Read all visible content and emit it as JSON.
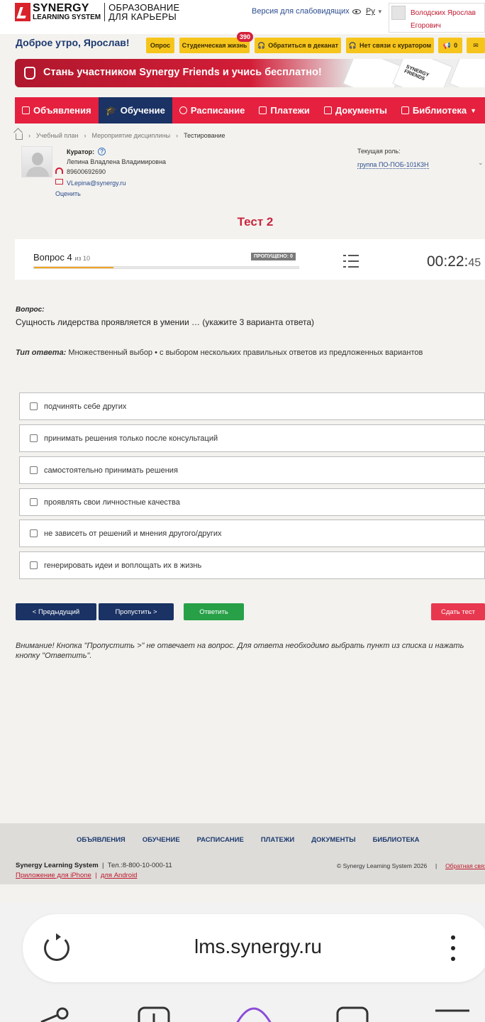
{
  "header": {
    "logo_main": "SYNERGY",
    "logo_sub": "LEARNING SYSTEM",
    "logo_right1": "ОБРАЗОВАНИЕ",
    "logo_right2": "ДЛЯ КАРЬЕРЫ",
    "vision_label": "Версия для слабовидящих",
    "lang": "Ру",
    "user_name": "Володских Ярослав Егорович"
  },
  "greeting": "Доброе утро, Ярослав!",
  "quick_buttons": {
    "survey": "Опрос",
    "student_life": "Студенческая жизнь",
    "student_life_badge": "390",
    "dean": "Обратиться в деканат",
    "curator": "Нет связи с куратором",
    "notifications_count": "0"
  },
  "banner": {
    "text": "Стань участником Synergy Friends и учись бесплатно!",
    "card_text": "SYNERGY FRIENDS"
  },
  "nav": {
    "items": [
      {
        "label": "Объявления"
      },
      {
        "label": "Обучение"
      },
      {
        "label": "Расписание"
      },
      {
        "label": "Платежи"
      },
      {
        "label": "Документы"
      },
      {
        "label": "Библиотека"
      }
    ]
  },
  "breadcrumb": [
    "Учебный план",
    "Мероприятие дисциплины",
    "Тестирование"
  ],
  "curator": {
    "label": "Куратор:",
    "name": "Лепина Владлена Владимировна",
    "phone": "89600692690",
    "email": "VLepina@synergy.ru",
    "rate": "Оценить"
  },
  "role": {
    "label": "Текущая роль:",
    "value": "группа ПО-ПОБ-101К3Н"
  },
  "test": {
    "title": "Тест 2",
    "question_label": "Вопрос 4",
    "question_of": "из 10",
    "skipped": "ПРОПУЩЕНО: 0",
    "progress": 0.3,
    "timer_main": "00:22:",
    "timer_sec": "45"
  },
  "question": {
    "head": "Вопрос:",
    "text": "Сущность лидерства проявляется в умении … (укажите 3 варианта ответа)",
    "type_label": "Тип ответа:",
    "type_text": "Множественный выбор • с выбором нескольких правильных ответов из предложенных вариантов"
  },
  "options": [
    "подчинять себе других",
    "принимать решения только после консультаций",
    "самостоятельно принимать решения",
    "проявлять свои личностные качества",
    "не зависеть от решений и мнения другого/других",
    "генерировать идеи и воплощать их в жизнь"
  ],
  "buttons": {
    "prev": "< Предыдущий",
    "skip": "Пропустить >",
    "answer": "Ответить",
    "submit": "Сдать тест"
  },
  "warning": "Внимание! Кнопка \"Пропустить >\" не отвечает на вопрос. Для ответа необходимо выбрать пункт из списка и нажать кнопку \"Ответить\".",
  "footer": {
    "nav": [
      "ОБЪЯВЛЕНИЯ",
      "ОБУЧЕНИЕ",
      "РАСПИСАНИЕ",
      "ПЛАТЕЖИ",
      "ДОКУМЕНТЫ",
      "БИБЛИОТЕКА"
    ],
    "company": "Synergy Learning System",
    "phone": "Тел.:8-800-10-000-11",
    "app_iphone": "Приложение для iPhone",
    "app_android": "для Android",
    "copyright": "© Synergy Learning System 2026",
    "feedback": "Обратная связь"
  },
  "browser": {
    "url": "lms.synergy.ru"
  },
  "colors": {
    "nav_red": "#e5213f",
    "nav_active": "#1a3264",
    "accent_yellow": "#f6c51c",
    "answer_green": "#27a048",
    "submit_red": "#e8384f"
  }
}
